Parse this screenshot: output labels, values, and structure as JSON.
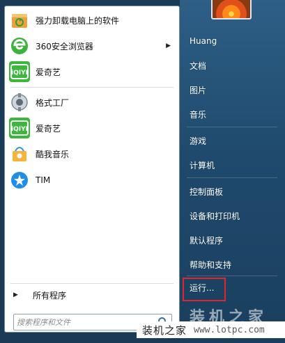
{
  "start_menu": {
    "pinned_programs": [
      {
        "label": "强力卸载电脑上的软件",
        "icon": "uninstall-box-icon"
      },
      {
        "label": "360安全浏览器",
        "icon": "360-browser-icon",
        "has_submenu": true
      },
      {
        "label": "爱奇艺",
        "icon": "iqiyi-icon"
      }
    ],
    "recent_programs": [
      {
        "label": "格式工厂",
        "icon": "format-factory-icon"
      },
      {
        "label": "爱奇艺",
        "icon": "iqiyi-icon"
      },
      {
        "label": "酷我音乐",
        "icon": "kuwo-music-icon"
      },
      {
        "label": "TIM",
        "icon": "tim-icon"
      }
    ],
    "all_programs_label": "所有程序",
    "search_placeholder": "搜索程序和文件"
  },
  "right_panel": {
    "user_name": "Huang",
    "items": [
      "文档",
      "图片",
      "音乐",
      "游戏",
      "计算机",
      "控制面板",
      "设备和打印机",
      "默认程序",
      "帮助和支持",
      "运行..."
    ]
  },
  "watermark": {
    "brand_big": "装机之家",
    "brand": "装机之家",
    "url": "www.lotpc.com"
  },
  "colors": {
    "highlight_box": "#e0262b",
    "right_panel": "#1f4a6d"
  }
}
